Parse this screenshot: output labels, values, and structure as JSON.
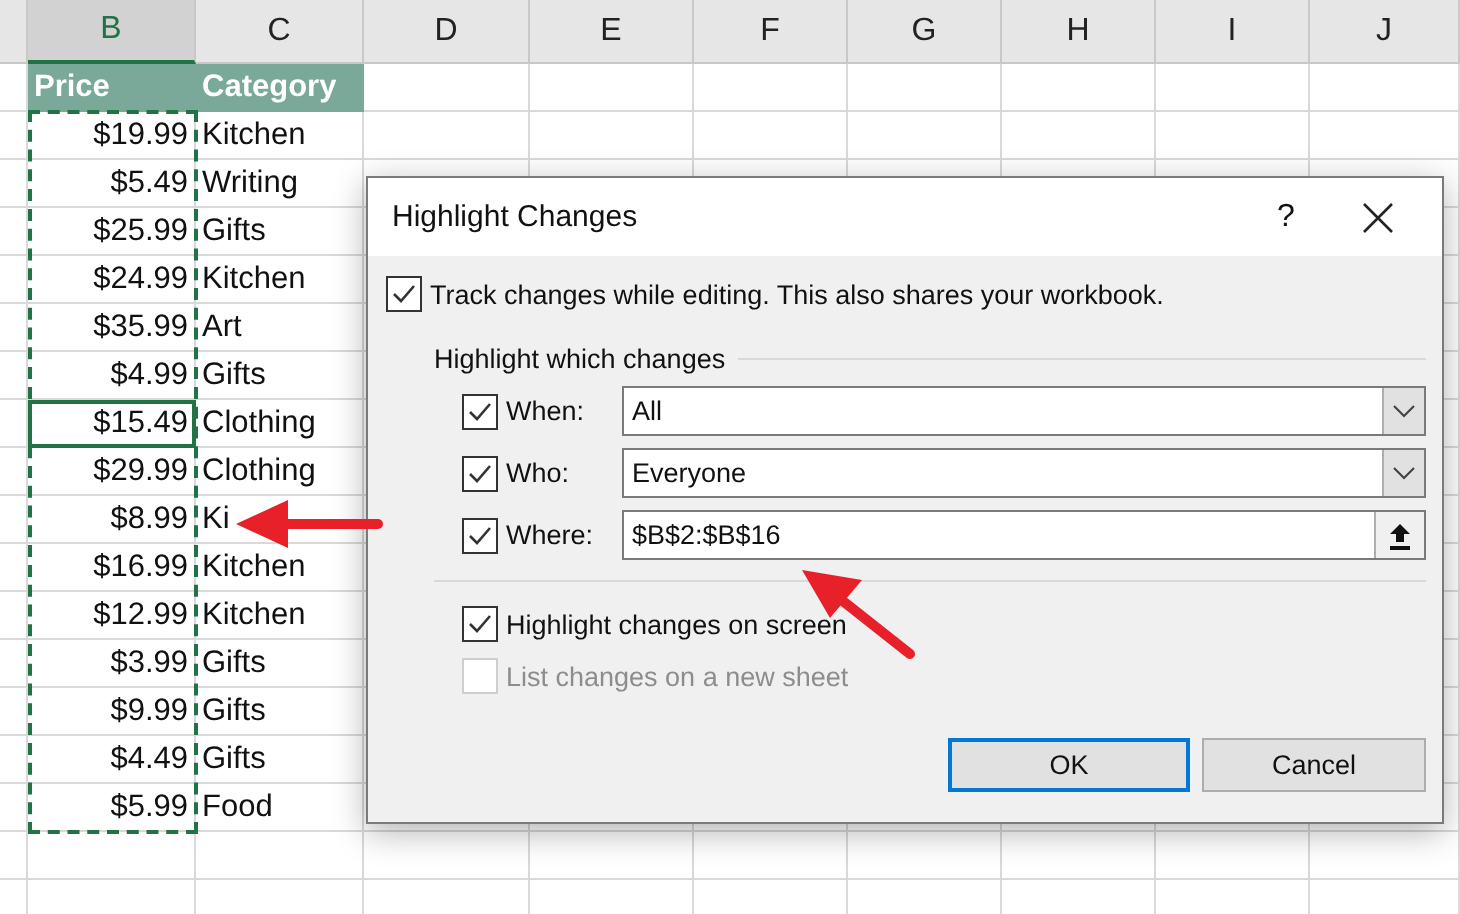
{
  "columns": [
    {
      "label": "B",
      "selected": true
    },
    {
      "label": "C",
      "selected": false
    },
    {
      "label": "D",
      "selected": false
    },
    {
      "label": "E",
      "selected": false
    },
    {
      "label": "F",
      "selected": false
    },
    {
      "label": "G",
      "selected": false
    },
    {
      "label": "H",
      "selected": false
    },
    {
      "label": "I",
      "selected": false
    },
    {
      "label": "J",
      "selected": false
    }
  ],
  "table": {
    "header": [
      "Price",
      "Category"
    ],
    "rows": [
      {
        "price": "$19.99",
        "category": "Kitchen",
        "active": false
      },
      {
        "price": "$5.49",
        "category": "Writing",
        "active": false
      },
      {
        "price": "$25.99",
        "category": "Gifts",
        "active": false
      },
      {
        "price": "$24.99",
        "category": "Kitchen",
        "active": false
      },
      {
        "price": "$35.99",
        "category": "Art",
        "active": false
      },
      {
        "price": "$4.99",
        "category": "Gifts",
        "active": false
      },
      {
        "price": "$15.49",
        "category": "Clothing",
        "active": true
      },
      {
        "price": "$29.99",
        "category": "Clothing",
        "active": false
      },
      {
        "price": "$8.99",
        "category": "Ki",
        "active": false
      },
      {
        "price": "$16.99",
        "category": "Kitchen",
        "active": false
      },
      {
        "price": "$12.99",
        "category": "Kitchen",
        "active": false
      },
      {
        "price": "$3.99",
        "category": "Gifts",
        "active": false
      },
      {
        "price": "$9.99",
        "category": "Gifts",
        "active": false
      },
      {
        "price": "$4.49",
        "category": "Gifts",
        "active": false
      },
      {
        "price": "$5.99",
        "category": "Food",
        "active": false
      }
    ]
  },
  "dialog": {
    "title": "Highlight Changes",
    "help": "?",
    "track": {
      "label": "Track changes while editing. This also shares your workbook.",
      "checked": true
    },
    "group_title": "Highlight which changes",
    "filters": [
      {
        "label": "When:",
        "checked": true,
        "value": "All",
        "kind": "dropdown"
      },
      {
        "label": "Who:",
        "checked": true,
        "value": "Everyone",
        "kind": "dropdown"
      },
      {
        "label": "Where:",
        "checked": true,
        "value": "$B$2:$B$16",
        "kind": "range"
      }
    ],
    "options": [
      {
        "label": "Highlight changes on screen",
        "checked": true,
        "disabled": false
      },
      {
        "label": "List changes on a new sheet",
        "checked": false,
        "disabled": true
      }
    ],
    "buttons": [
      {
        "label": "OK",
        "default": true
      },
      {
        "label": "Cancel",
        "default": false
      }
    ]
  }
}
